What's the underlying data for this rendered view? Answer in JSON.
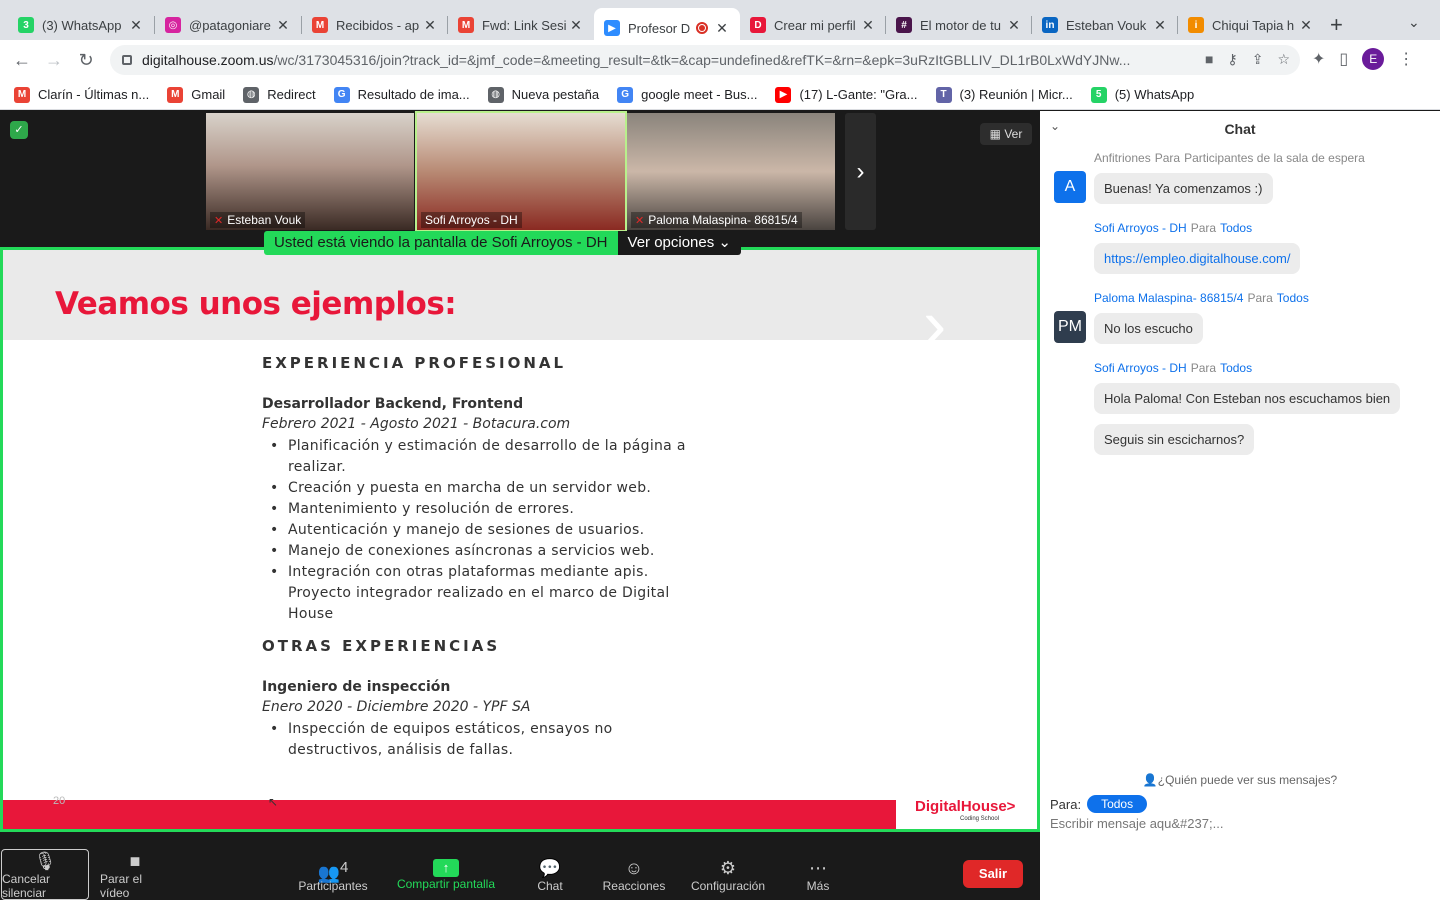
{
  "tabs": [
    {
      "title": "(3) WhatsApp",
      "icon": "whatsapp-icon",
      "color": "#25d366",
      "glyph": "3"
    },
    {
      "title": "@patagoniare",
      "icon": "instagram-icon",
      "color": "#d6249f",
      "glyph": "◎"
    },
    {
      "title": "Recibidos - ap",
      "icon": "gmail-icon",
      "color": "#ea4335",
      "glyph": "M"
    },
    {
      "title": "Fwd: Link Sesi",
      "icon": "gmail-icon",
      "color": "#ea4335",
      "glyph": "M"
    },
    {
      "title": "Profesor D",
      "icon": "zoom-icon",
      "color": "#2d8cff",
      "glyph": "▶"
    },
    {
      "title": "Crear mi perfil",
      "icon": "digitalhouse-icon",
      "color": "#e8173a",
      "glyph": "D"
    },
    {
      "title": "El motor de tu",
      "icon": "slack-icon",
      "color": "#4a154b",
      "glyph": "#"
    },
    {
      "title": "Esteban Vouk",
      "icon": "linkedin-icon",
      "color": "#0a66c2",
      "glyph": "in"
    },
    {
      "title": "Chiqui Tapia h",
      "icon": "infobae-icon",
      "color": "#f28c00",
      "glyph": "i"
    }
  ],
  "url": {
    "domain": "digitalhouse.zoom.us",
    "path": "/wc/3173045316/join?track_id=&jmf_code=&meeting_result=&tk=&cap=undefined&refTK=&rn=&epk=3uRzItGBLLIV_DL1rB0LxWdYJNw..."
  },
  "profile_initial": "E",
  "bookmarks": [
    {
      "label": "Clarín - Últimas n...",
      "icon": "gmail-icon",
      "color": "#ea4335",
      "glyph": "M"
    },
    {
      "label": "Gmail",
      "icon": "gmail-icon",
      "color": "#ea4335",
      "glyph": "M"
    },
    {
      "label": "Redirect",
      "icon": "globe-icon",
      "color": "#5f6368",
      "glyph": "◍"
    },
    {
      "label": "Resultado de ima...",
      "icon": "google-icon",
      "color": "#4285f4",
      "glyph": "G"
    },
    {
      "label": "Nueva pestaña",
      "icon": "globe-icon",
      "color": "#5f6368",
      "glyph": "◍"
    },
    {
      "label": "google meet - Bus...",
      "icon": "google-icon",
      "color": "#4285f4",
      "glyph": "G"
    },
    {
      "label": "(17) L-Gante: \"Gra...",
      "icon": "youtube-icon",
      "color": "#ff0000",
      "glyph": "▶"
    },
    {
      "label": "(3) Reunión | Micr...",
      "icon": "teams-icon",
      "color": "#6264a7",
      "glyph": "T"
    },
    {
      "label": "(5) WhatsApp",
      "icon": "whatsapp-icon",
      "color": "#25d366",
      "glyph": "5"
    }
  ],
  "participants": [
    {
      "name": "Esteban Vouk",
      "bg": "#8a6a50"
    },
    {
      "name": "Sofi Arroyos - DH",
      "bg": "#c9b8a8"
    },
    {
      "name": "Paloma Malaspina- 86815/4",
      "bg": "#6e665e"
    }
  ],
  "ver_label": "Ver",
  "share_banner": "Usted está viendo la pantalla de Sofi Arroyos - DH",
  "ver_opciones": "Ver opciones",
  "slide": {
    "title": "Veamos unos ejemplos:",
    "section1": "EXPERIENCIA PROFESIONAL",
    "job1": "Desarrollador Backend, Frontend",
    "dates1": "Febrero 2021 - Agosto 2021 - Botacura.com",
    "bullets1": [
      "Planificación y estimación de desarrollo de la página a",
      "realizar.",
      "Creación y puesta en marcha de un servidor web.",
      "Mantenimiento y resolución de errores.",
      "Autenticación y manejo de sesiones de usuarios.",
      "Manejo de conexiones asíncronas a servicios web.",
      "Integración con otras plataformas mediante apis.",
      "Proyecto integrador realizado en el marco de Digital",
      "House"
    ],
    "section2": "OTRAS EXPERIENCIAS",
    "job2": "Ingeniero de inspección",
    "dates2": "Enero 2020 - Diciembre 2020 - YPF SA",
    "bullets2": [
      "Inspección de equipos estáticos, ensayos no",
      "destructivos, análisis de fallas."
    ],
    "page_number": "20",
    "logo": "DigitalHouse>",
    "logo_sub": "Coding School"
  },
  "controls": {
    "mute": "Cancelar silenciar",
    "video": "Parar el vídeo",
    "participants": "Participantes",
    "participants_count": "4",
    "share": "Compartir pantalla",
    "chat": "Chat",
    "reactions": "Reacciones",
    "settings": "Configuración",
    "more": "Más",
    "leave": "Salir"
  },
  "chat": {
    "title": "Chat",
    "to_word": "Para",
    "messages": [
      {
        "sender": "Anfitriones",
        "target": "Participantes de la sala de espera",
        "text": "Buenas! Ya comenzamos :)"
      },
      {
        "sender": "Sofi Arroyos - DH",
        "target": "Todos",
        "text": "https://empleo.digitalhouse.com/"
      },
      {
        "sender": "Paloma Malaspina- 86815/4",
        "target": "Todos",
        "text": "No los escucho"
      },
      {
        "sender": "Sofi Arroyos - DH",
        "target": "Todos",
        "text": "Hola Paloma! Con Esteban nos escuchamos bien",
        "text2": "Seguis sin escicharnos?"
      }
    ],
    "avatar_a": "A",
    "avatar_pm": "PM",
    "who_can_see": "¿Quién puede ver sus mensajes?",
    "para_label": "Para:",
    "todos_label": "Todos",
    "placeholder": "Escribir mensaje aqu&#237;..."
  }
}
